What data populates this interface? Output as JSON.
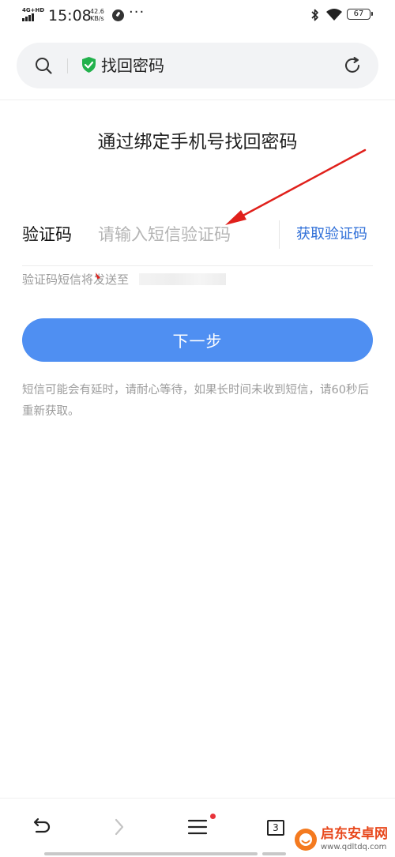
{
  "status_bar": {
    "network": "4G+HD",
    "time": "15:08",
    "speed_value": "42.6",
    "speed_unit": "KB/s",
    "more": "···",
    "battery": "67"
  },
  "address_bar": {
    "title": "找回密码"
  },
  "main": {
    "heading": "通过绑定手机号找回密码",
    "code_label": "验证码",
    "code_input_value": "",
    "code_input_placeholder": "请输入短信验证码",
    "get_code_label": "获取验证码",
    "sent_hint": "验证码短信将发送至",
    "next_label": "下一步",
    "notice": "短信可能会有延时，请耐心等待，如果长时间未收到短信，请60秒后重新获取。"
  },
  "bottom_nav": {
    "tab_count": "3",
    "menu_has_badge": true
  },
  "watermark": {
    "name": "启东安卓网",
    "url": "www.qdltdq.com"
  },
  "colors": {
    "primary_button": "#4f8ff2",
    "link": "#2f6fd8",
    "shield": "#22b14c",
    "annotation_arrow": "#e0201b",
    "badge": "#e8333a"
  }
}
